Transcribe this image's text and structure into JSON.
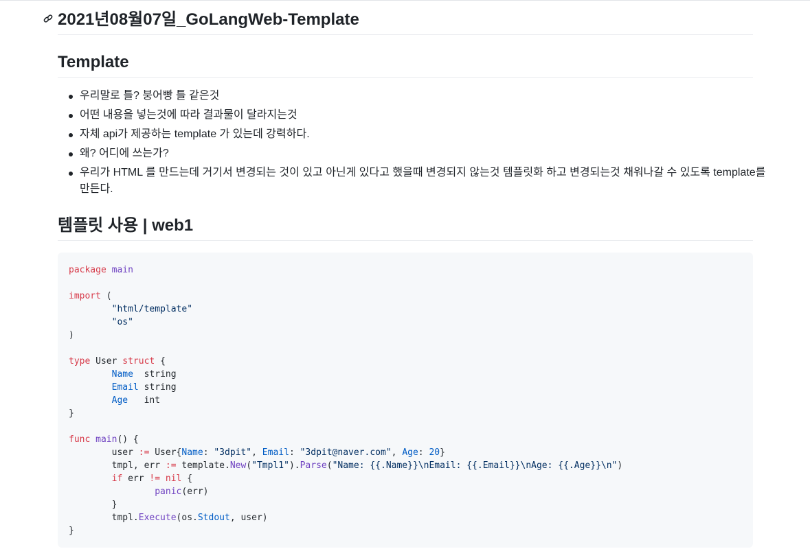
{
  "title": "2021년08월07일_GoLangWeb-Template",
  "section_template": {
    "heading": "Template",
    "bullets": [
      "우리말로 틀? 붕어빵 틀 같은것",
      "어떤 내용을 넣는것에 따라 결과물이 달라지는것",
      "자체 api가 제공하는 template 가 있는데 강력하다.",
      "왜? 어디에 쓰는가?",
      "우리가 HTML 를 만드는데 거기서 변경되는 것이 있고 아닌게 있다고 했을때 변경되지 않는것 템플릿화 하고 변경되는것 채워나갈 수 있도록 template를 만든다."
    ]
  },
  "section_web1": {
    "heading": "템플릿 사용 | web1"
  },
  "code_lines": [
    "package main",
    "",
    "import (",
    "        \"html/template\"",
    "        \"os\"",
    ")",
    "",
    "type User struct {",
    "        Name  string",
    "        Email string",
    "        Age   int",
    "}",
    "",
    "func main() {",
    "        user := User{Name: \"3dpit\", Email: \"3dpit@naver.com\", Age: 20}",
    "        tmpl, err := template.New(\"Tmpl1\").Parse(\"Name: {{.Name}}\\nEmail: {{.Email}}\\nAge: {{.Age}}\\n\")",
    "        if err != nil {",
    "                panic(err)",
    "        }",
    "        tmpl.Execute(os.Stdout, user)",
    "}"
  ],
  "colors": {
    "keyword": "#d73a49",
    "function": "#6f42c1",
    "string": "#032f62",
    "field": "#005cc5",
    "code_bg": "#f6f8fa"
  },
  "icons": {
    "heading_anchor": "link-icon"
  }
}
